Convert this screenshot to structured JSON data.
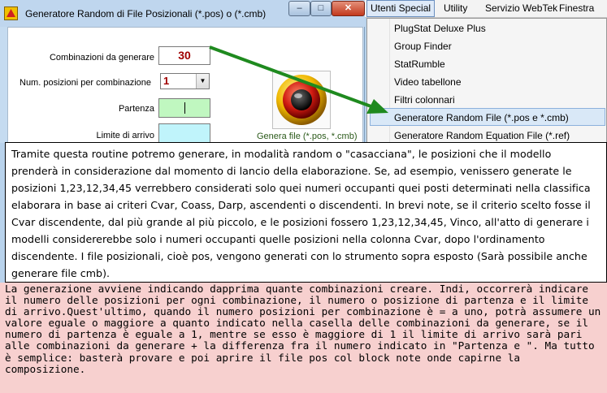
{
  "window": {
    "title": "Generatore Random di File Posizionali (*.pos) o (*.cmb)",
    "minimize_glyph": "–",
    "maximize_glyph": "□",
    "close_glyph": "✕"
  },
  "form": {
    "combinazioni_label": "Combinazioni da generare",
    "combinazioni_value": "30",
    "num_posizioni_label": "Num. posizioni per combinazione",
    "num_posizioni_value": "1",
    "partenza_label": "Partenza",
    "limite_label": "Limite di arrivo",
    "genera_label": "Genera file (*.pos, *.cmb)"
  },
  "menubar": {
    "items": [
      "Utenti Special",
      "Utility",
      "Servizio WebTek",
      "Finestra"
    ]
  },
  "dropdown": {
    "items": [
      "PlugStat Deluxe Plus",
      "Group Finder",
      "StatRumble",
      "Video tabellone",
      "Filtri colonnari",
      "Generatore Random File (*.pos e *.cmb)",
      "Generatore Random Equation File (*.ref)"
    ],
    "highlighted_index": 5
  },
  "description": "Tramite questa routine potremo generare, in modalità random o \"casacciana\", le posizioni che il modello prenderà in considerazione dal momento di lancio della elaborazione. Se, ad esempio, venissero generate le posizioni 1,23,12,34,45 verrebbero considerati solo quei numeri occupanti quei posti determinati nella classifica elaborara in base ai criteri Cvar, Coass, Darp, ascendenti o discendenti. In brevi note, se il criterio scelto fosse il Cvar discendente, dal più grande al più piccolo, e le posizioni fossero 1,23,12,34,45, Vinco, all'atto di generare i modelli considererebbe solo i numeri occupanti quelle posizioni nella colonna Cvar, dopo l'ordinamento discendente. I file posizionali, cioè pos, vengono generati con lo strumento sopra esposto (Sarà possibile anche generare file cmb).",
  "note": "La generazione avviene indicando dapprima quante combinazioni creare. Indi, occorrerà indicare il numero delle posizioni per ogni combinazione, il numero o posizione di partenza e il limite di arrivo.Quest'ultimo, quando il numero posizioni per combinazione è = a uno, potrà assumere un valore eguale o maggiore a quanto indicato nella casella delle combinazioni da generare, se il numero di partenza è eguale a 1, mentre se esso è maggiore di 1 il limite di arrivo sarà pari alle combinazioni da generare + la differenza fra il numero indicato in \"Partenza e \". Ma tutto è semplice: basterà provare e poi aprire il file pos col block note onde capirne la composizione.",
  "colors": {
    "arrow": "#1f8a1f",
    "combinazioni_text": "#a00000",
    "partenza_bg": "#c0f7c0",
    "limite_bg": "#c0f4fb",
    "note_bg": "#f7d0cf",
    "menu_highlight": "#d9e8f7"
  }
}
